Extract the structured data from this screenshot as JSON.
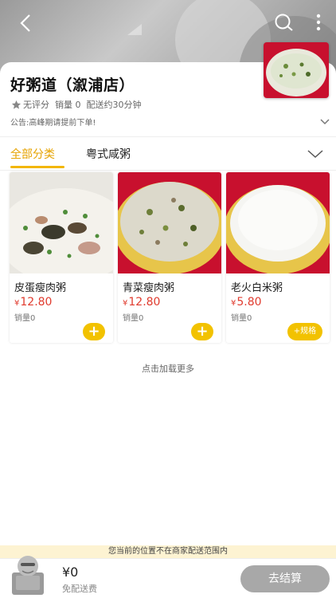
{
  "shop": {
    "name": "好粥道（溆浦店）",
    "rating": "无评分",
    "sales": "销量 0",
    "delivery_time": "配送约30分钟",
    "notice": "公告:高峰期请提前下单!"
  },
  "tabs": [
    {
      "label": "全部分类"
    },
    {
      "label": "粤式咸粥"
    }
  ],
  "products": [
    {
      "name": "皮蛋瘦肉粥",
      "currency": "¥",
      "price": "12.80",
      "sales": "销量0",
      "action": "+"
    },
    {
      "name": "青菜瘦肉粥",
      "currency": "¥",
      "price": "12.80",
      "sales": "销量0",
      "action": "+"
    },
    {
      "name": "老火白米粥",
      "currency": "¥",
      "price": "5.80",
      "sales": "销量0",
      "action": "+规格"
    }
  ],
  "load_more": "点击加载更多",
  "cart": {
    "warning": "您当前的位置不在商家配送范围内",
    "total": "¥0",
    "delivery_fee": "免配送费",
    "checkout": "去结算"
  },
  "colors": {
    "accent": "#f2c200",
    "active_tab": "#e6a300",
    "price": "#e03b2e",
    "checkout_disabled": "#a8a8a8"
  },
  "icons": [
    "back-icon",
    "search-icon",
    "more-icon",
    "star-icon",
    "chevron-down-icon",
    "cart-icon"
  ]
}
